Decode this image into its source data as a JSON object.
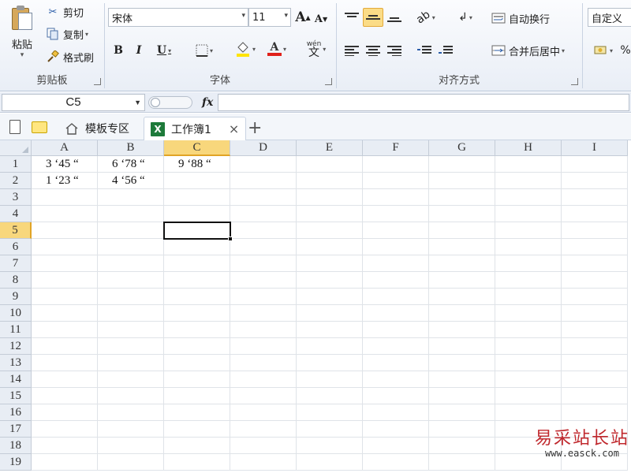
{
  "ribbon": {
    "clipboard": {
      "paste_label": "粘贴",
      "cut_label": "剪切",
      "copy_label": "复制",
      "format_painter_label": "格式刷",
      "group_label": "剪贴板"
    },
    "font": {
      "font_name": "宋体",
      "font_size": "11",
      "grow_label": "A",
      "shrink_label": "A",
      "bold": "B",
      "italic": "I",
      "underline": "U",
      "font_color_label": "A",
      "wen_label": "wén",
      "wen_char": "文",
      "group_label": "字体"
    },
    "alignment": {
      "wrap_text_label": "自动换行",
      "merge_center_label": "合并后居中",
      "group_label": "对齐方式"
    },
    "number": {
      "format_value": "自定义",
      "percent": "%"
    }
  },
  "formula_bar": {
    "name_box": "C5",
    "fx_label": "fx",
    "formula": ""
  },
  "tabs": {
    "template_tab": "模板专区",
    "workbook_tab": "工作簿1",
    "xl_letter": "X",
    "close_symbol": "×",
    "add_symbol": "+"
  },
  "sheet": {
    "columns": [
      "A",
      "B",
      "C",
      "D",
      "E",
      "F",
      "G",
      "H",
      "I"
    ],
    "selected_column": "C",
    "rows": [
      "1",
      "2",
      "3",
      "4",
      "5",
      "6",
      "7",
      "8",
      "9",
      "10",
      "11",
      "12",
      "13",
      "14",
      "15",
      "16",
      "17",
      "18",
      "19"
    ],
    "selected_row": "5",
    "cells": {
      "A1": "3 ‘45 “",
      "B1": "6 ‘78 “",
      "C1": "9 ‘88 “",
      "A2": "1 ‘23 “",
      "B2": "4 ‘56 “"
    },
    "active_cell": "C5"
  },
  "watermark": {
    "cn": "易采站长站",
    "url": "www.easck.com"
  },
  "colors": {
    "selection_header": "#f8d77c",
    "selected_button": "#fbdc87",
    "font_color_bar": "#e0201a",
    "fill_color_bar": "#ffe400",
    "watermark_red": "#c0282d"
  }
}
